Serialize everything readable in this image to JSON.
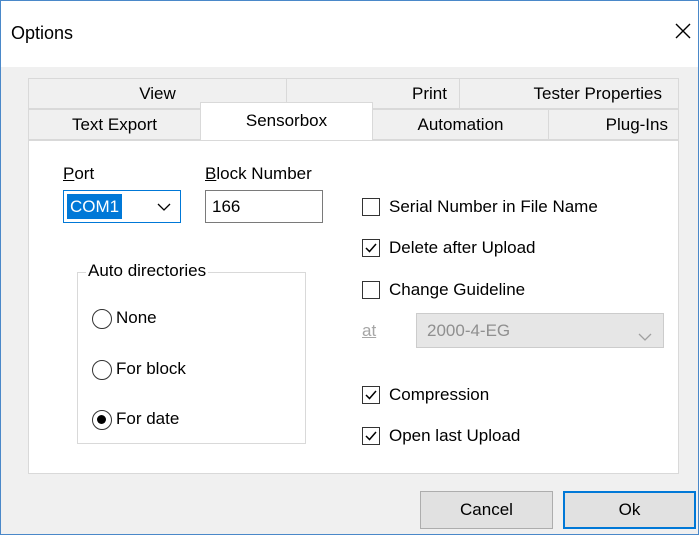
{
  "window": {
    "title": "Options"
  },
  "tabs": {
    "row1": [
      {
        "label": "View"
      },
      {
        "label": "Print"
      },
      {
        "label": "Tester Properties"
      }
    ],
    "row2": [
      {
        "label": "Text Export"
      },
      {
        "label": "Sensorbox",
        "active": true
      },
      {
        "label": "Automation"
      },
      {
        "label": "Plug-Ins"
      }
    ]
  },
  "sensorbox": {
    "port": {
      "label": "Port",
      "accel": "P",
      "rest": "ort",
      "value": "COM1"
    },
    "block_number": {
      "label": "Block Number",
      "accel": "B",
      "rest": "lock Number",
      "value": "166"
    },
    "auto_directories": {
      "legend": "Auto directories",
      "options": [
        {
          "label": "None",
          "selected": false
        },
        {
          "label": "For block",
          "selected": false
        },
        {
          "label": "For date",
          "selected": true
        }
      ]
    },
    "checkboxes": {
      "serial_number": {
        "label": "Serial Number in File Name",
        "checked": false
      },
      "delete_after_upload": {
        "label": "Delete after Upload",
        "checked": true
      },
      "change_guideline": {
        "label": "Change Guideline",
        "checked": false
      },
      "compression": {
        "label": "Compression",
        "checked": true
      },
      "open_last_upload": {
        "label": "Open last Upload",
        "checked": true
      }
    },
    "guideline": {
      "at_label": "at",
      "value": "2000-4-EG",
      "enabled": false
    }
  },
  "buttons": {
    "cancel": "Cancel",
    "ok": "Ok"
  },
  "colors": {
    "accent": "#0078d7",
    "window_border": "#4a88c9",
    "face": "#f0f0f0"
  }
}
